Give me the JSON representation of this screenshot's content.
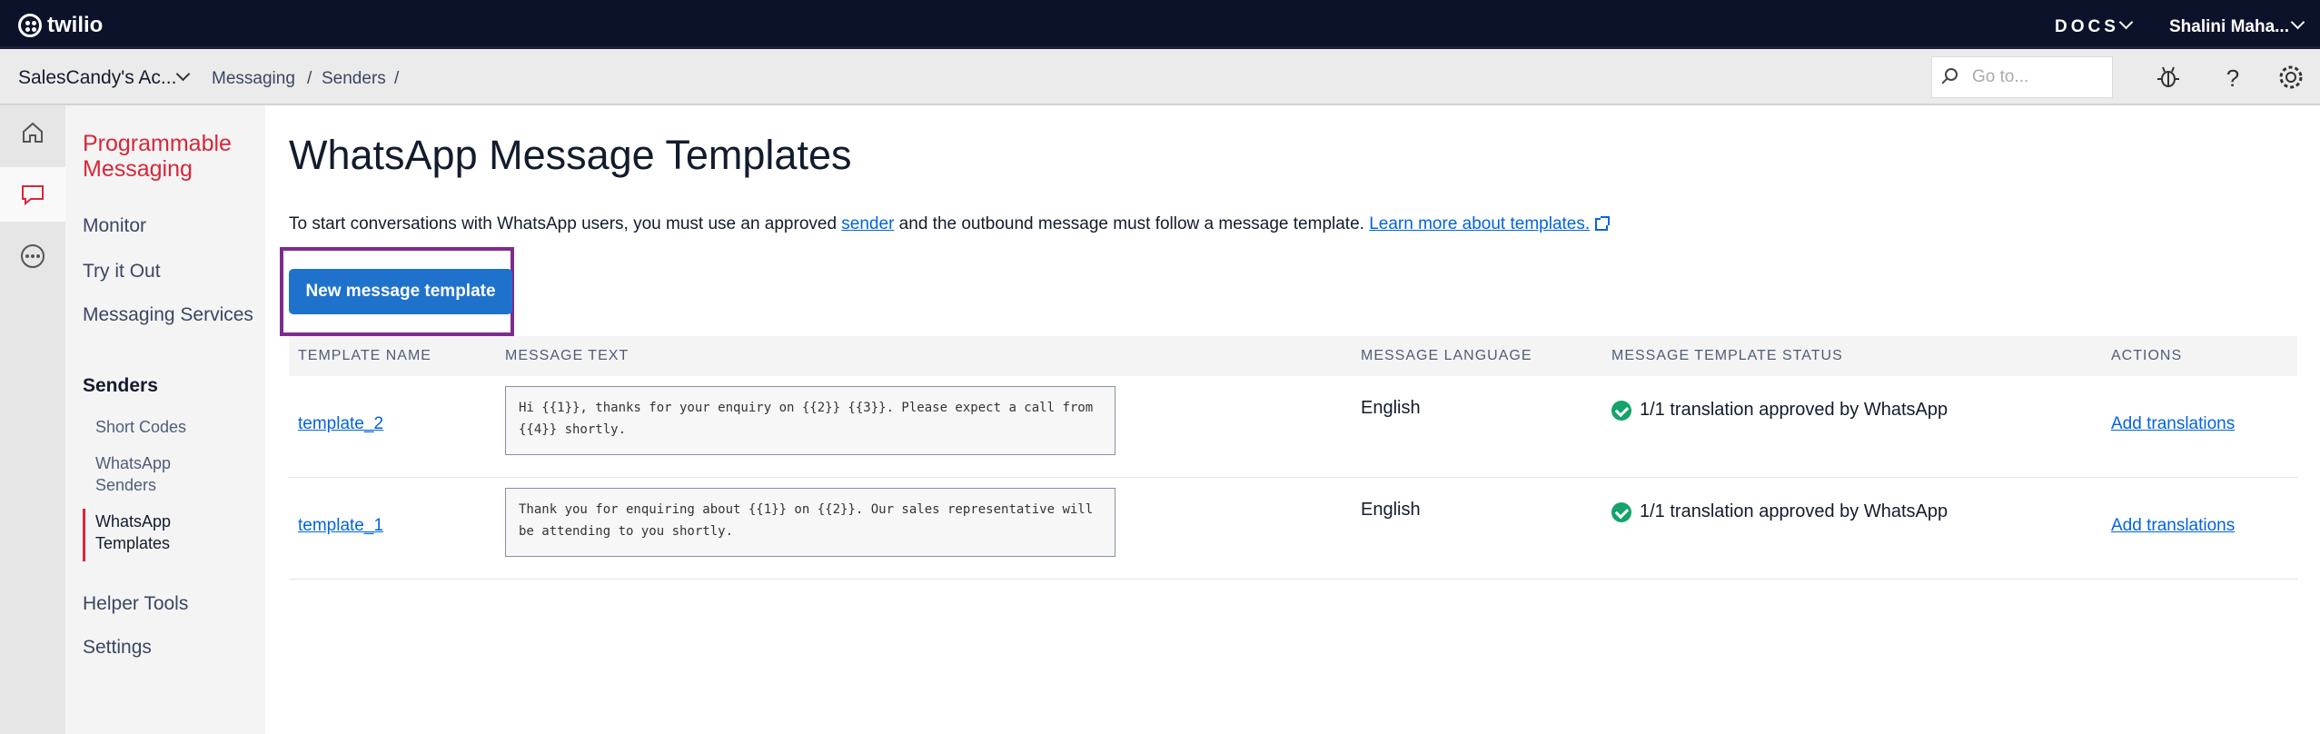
{
  "topbar": {
    "brand": "twilio",
    "docs_label": "DOCS",
    "user_name": "Shalini Maha..."
  },
  "subbar": {
    "account_name": "SalesCandy's Ac...",
    "breadcrumb": [
      "Messaging",
      "/",
      "Senders",
      "/"
    ],
    "search_placeholder": "Go to..."
  },
  "sidebar": {
    "product_title": "Programmable Messaging",
    "items": [
      {
        "label": "Monitor"
      },
      {
        "label": "Try it Out"
      },
      {
        "label": "Messaging Services"
      },
      {
        "label": "Senders"
      },
      {
        "label": "Helper Tools"
      },
      {
        "label": "Settings"
      }
    ],
    "sub_items": [
      {
        "label": "Short Codes"
      },
      {
        "label": "WhatsApp Senders"
      },
      {
        "label": "WhatsApp Templates"
      }
    ]
  },
  "main": {
    "title": "WhatsApp Message Templates",
    "intro_before": "To start conversations with WhatsApp users, you must use an approved ",
    "intro_link": "sender",
    "intro_after": " and the outbound message must follow a message template. ",
    "learn_more": "Learn more about templates.",
    "new_button": "New message template"
  },
  "table": {
    "headers": [
      "TEMPLATE NAME",
      "MESSAGE TEXT",
      "MESSAGE LANGUAGE",
      "MESSAGE TEMPLATE STATUS",
      "ACTIONS"
    ],
    "rows": [
      {
        "name": "template_2",
        "message": "Hi {{1}}, thanks for your enquiry on {{2}} {{3}}. Please expect a call from {{4}} shortly.",
        "language": "English",
        "status": "1/1 translation approved by WhatsApp",
        "action": "Add translations"
      },
      {
        "name": "template_1",
        "message": "Thank you for enquiring about {{1}} on {{2}}.  Our sales representative will be attending to you shortly.",
        "language": "English",
        "status": "1/1 translation approved by WhatsApp",
        "action": "Add translations"
      }
    ]
  },
  "colors": {
    "topbar_bg": "#0d122b",
    "brand_red": "#d9263a",
    "primary_blue": "#1f72cc",
    "link_blue": "#0263e0",
    "highlight_purple": "#7e2b90",
    "status_green": "#14a36b"
  }
}
